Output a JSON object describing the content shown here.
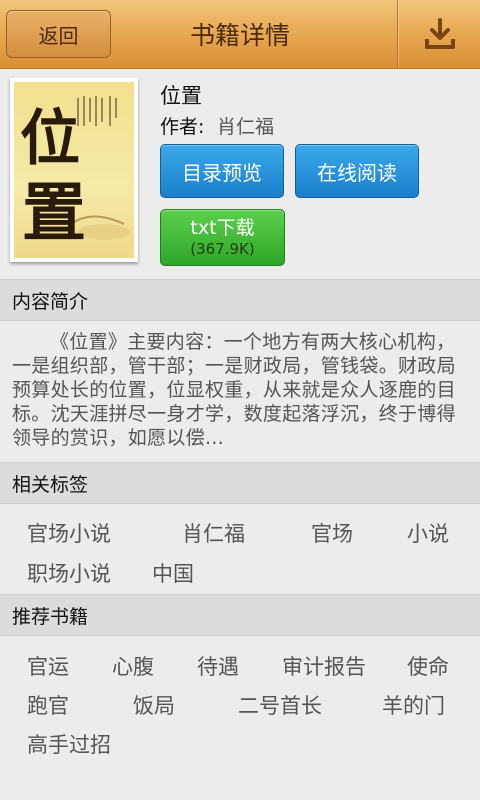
{
  "header": {
    "back_label": "返回",
    "title": "书籍详情",
    "download_icon": "download-icon"
  },
  "book": {
    "cover_title_chars": [
      "位",
      "置"
    ],
    "title": "位置",
    "author_label": "作者:",
    "author": "肖仁福",
    "toc_button": "目录预览",
    "read_button": "在线阅读",
    "txt_button": "txt下载",
    "txt_size": "(367.9K)"
  },
  "summary": {
    "heading": "内容简介",
    "text": "《位置》主要内容：一个地方有两大核心机构，一是组织部，管干部；一是财政局，管钱袋。财政局预算处长的位置，位显权重，从来就是众人逐鹿的目标。沈天涯拼尽一身才学，数度起落浮沉，终于博得领导的赏识，如愿以偿..."
  },
  "tags": {
    "heading": "相关标签",
    "items": [
      "官场小说",
      "肖仁福",
      "官场",
      "小说",
      "职场小说",
      "中国"
    ]
  },
  "recommended": {
    "heading": "推荐书籍",
    "items": [
      "官运",
      "心腹",
      "待遇",
      "审计报告",
      "使命",
      "跑官",
      "饭局",
      "二号首长",
      "羊的门",
      "高手过招"
    ]
  }
}
